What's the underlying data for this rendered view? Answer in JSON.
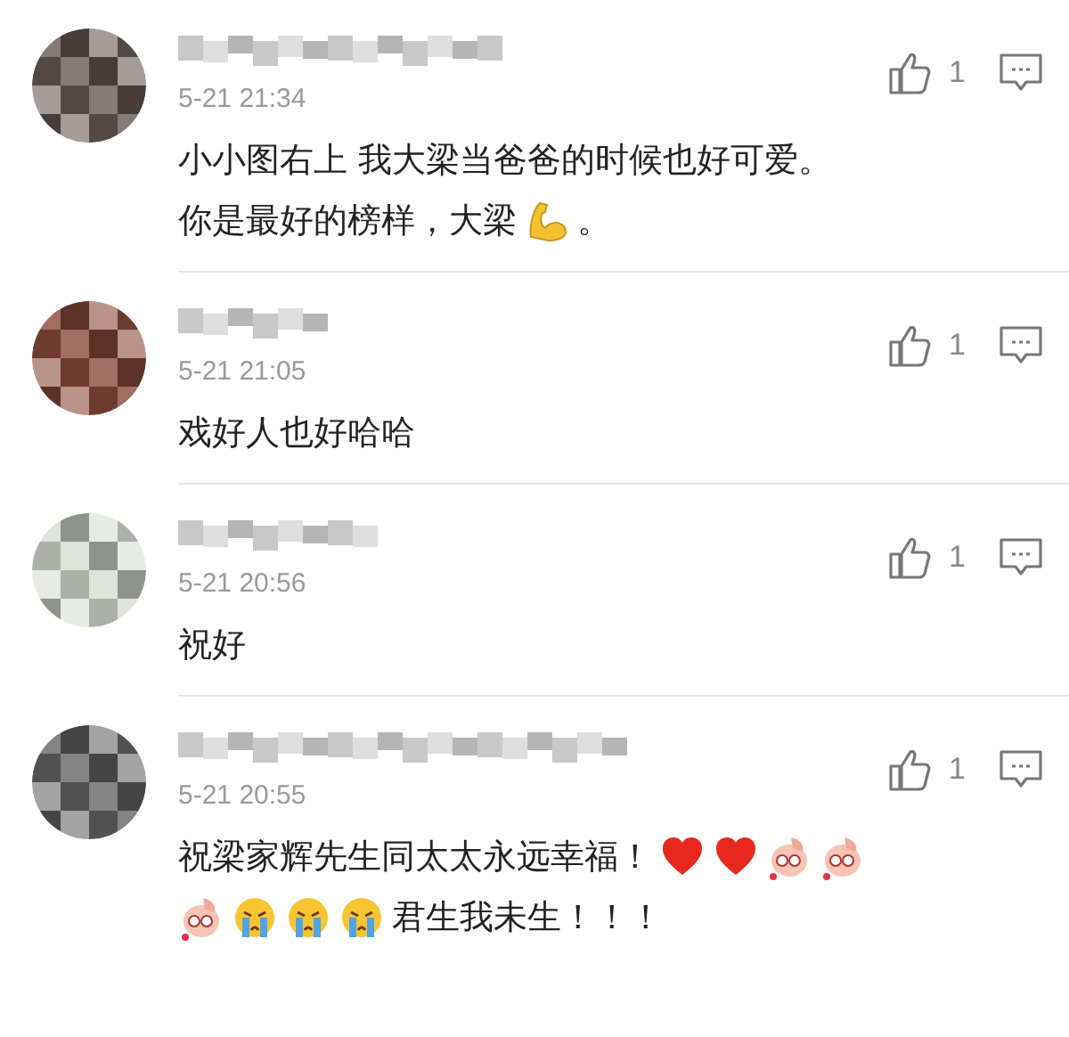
{
  "comments": [
    {
      "time": "5-21 21:34",
      "likes": "1",
      "lines": [
        [
          {
            "kind": "text",
            "text": "小小图右上 我大梁当爸爸的时候也好可爱。"
          }
        ],
        [
          {
            "kind": "text",
            "text": "你是最好的榜样，大梁"
          },
          {
            "kind": "flexed-arm"
          },
          {
            "kind": "text",
            "text": "。"
          }
        ]
      ]
    },
    {
      "time": "5-21 21:05",
      "likes": "1",
      "lines": [
        [
          {
            "kind": "text",
            "text": "戏好人也好哈哈"
          }
        ]
      ]
    },
    {
      "time": "5-21 20:56",
      "likes": "1",
      "lines": [
        [
          {
            "kind": "text",
            "text": "祝好"
          }
        ]
      ]
    },
    {
      "time": "5-21 20:55",
      "likes": "1",
      "lines": [
        [
          {
            "kind": "text",
            "text": "祝梁家辉先生同太太永远幸福！"
          },
          {
            "kind": "heart"
          },
          {
            "kind": "heart"
          },
          {
            "kind": "cartoon-creature"
          },
          {
            "kind": "cartoon-creature"
          }
        ],
        [
          {
            "kind": "cartoon-creature"
          },
          {
            "kind": "crying-face"
          },
          {
            "kind": "crying-face"
          },
          {
            "kind": "crying-face"
          },
          {
            "kind": "text",
            "text": "君生我未生！！！"
          }
        ]
      ]
    }
  ]
}
